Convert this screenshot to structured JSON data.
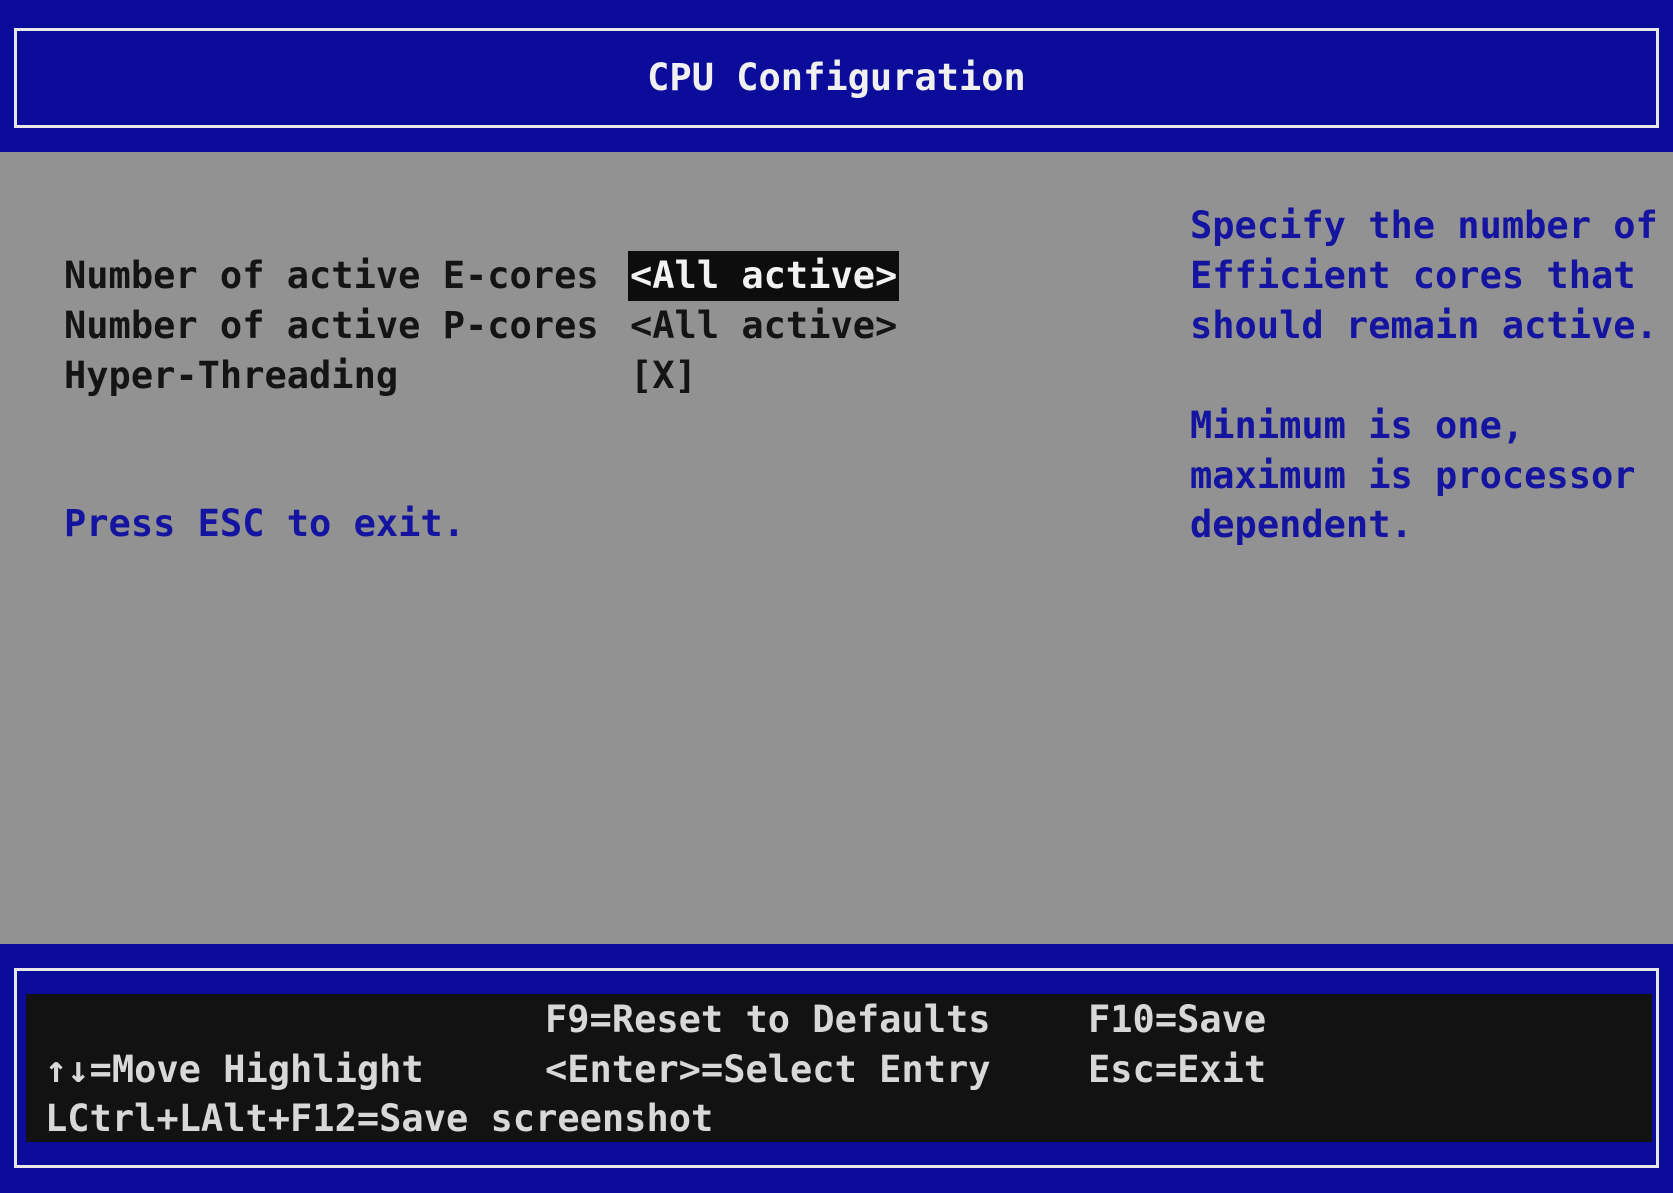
{
  "header": {
    "title": "CPU Configuration"
  },
  "settings": [
    {
      "label": "Number of active E-cores",
      "value": "<All active>",
      "selected": true
    },
    {
      "label": "Number of active P-cores",
      "value": "<All active>",
      "selected": false
    },
    {
      "label": "Hyper-Threading",
      "value": "[X]",
      "selected": false
    }
  ],
  "hint": "Press ESC to exit.",
  "help": {
    "lines": [
      "Specify the number of",
      "Efficient cores that",
      "should remain active.",
      "",
      "Minimum is one,",
      "maximum is processor",
      "dependent."
    ]
  },
  "footer": {
    "reset": "F9=Reset to Defaults",
    "save": "F10=Save",
    "move": "↑↓=Move Highlight",
    "select": "<Enter>=Select Entry",
    "exit": "Esc=Exit",
    "screenshot": "LCtrl+LAlt+F12=Save screenshot"
  },
  "colors": {
    "background": "#929292",
    "header_blue": "#0c0c9a",
    "help_text": "#1414a0",
    "selection_bg": "#0d0d0d"
  }
}
